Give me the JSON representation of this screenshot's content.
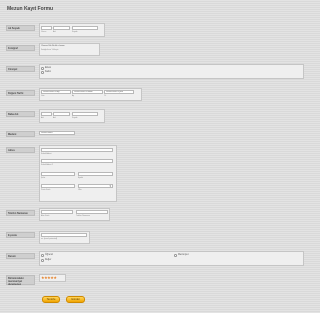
{
  "form": {
    "title": "Mezun Kayıt Formu",
    "name": {
      "label": "Ad Soyadı",
      "sub": [
        "Ünvan",
        "Adı",
        "Soyadı"
      ]
    },
    "photo": {
      "label": "Fotoğraf",
      "button": "Choose File",
      "no_file": "No file chosen",
      "hint": "Fotoğrafınızı Yükleyin"
    },
    "gender": {
      "label": "Cinsiyet",
      "options": [
        "Erkek",
        "Kadın"
      ]
    },
    "birthdate": {
      "label": "Doğum Tarihi",
      "selects": [
        "Please select a day",
        "Please select a month",
        "Please select a year"
      ],
      "sub": [
        "Gün",
        "Ay",
        "Yıl"
      ]
    },
    "father_name": {
      "label": "Baba Adı",
      "sub": [
        "Adı",
        "Adı",
        "Soyadı"
      ]
    },
    "marital": {
      "label": "Medeni",
      "select": "Please Select"
    },
    "address": {
      "label": "Adres",
      "sub": [
        "Sokak Adresi",
        "Sokak Adresi 2",
        "Şehir",
        "Eyalet",
        "Posta Kodu",
        "Ülke"
      ]
    },
    "phone": {
      "label": "Telefon Numarası",
      "sub": [
        "Alan Kodu",
        "Telefon Numarası"
      ]
    },
    "email": {
      "label": "E-posta",
      "sub": "ex: [email protected]"
    },
    "status": {
      "label": "Durum",
      "options": [
        "Öğrenci",
        "Değer",
        "Mezuniyet"
      ]
    },
    "rating": {
      "label": "Birimimizdeki memnuniyet durumunuz",
      "stars": 5
    },
    "buttons": {
      "clear": "Temizle",
      "submit": "Gönder"
    }
  }
}
